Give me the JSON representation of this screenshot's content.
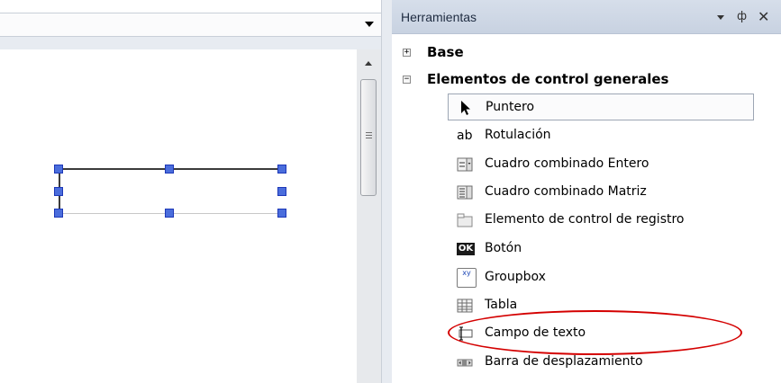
{
  "tool_panel": {
    "title": "Herramientas",
    "dropdown_icon": "chevron-down-icon",
    "pin_glyph": "ф",
    "close_glyph": "✕",
    "categories": [
      {
        "label": "Base",
        "expander": "+",
        "expanded": false
      },
      {
        "label": "Elementos de control generales",
        "expander": "−",
        "expanded": true
      }
    ],
    "items": [
      {
        "label": "Puntero",
        "icon": "pointer-arrow-icon",
        "selected": true
      },
      {
        "label": "Rotulación",
        "icon": "ab-label-icon",
        "icon_text": "ab"
      },
      {
        "label": "Cuadro combinado Entero",
        "icon": "combobox-integer-icon"
      },
      {
        "label": "Cuadro combinado Matriz",
        "icon": "combobox-matrix-icon"
      },
      {
        "label": "Elemento de control de registro",
        "icon": "tab-control-icon"
      },
      {
        "label": "Botón",
        "icon": "ok-button-icon",
        "icon_text": "OK"
      },
      {
        "label": "Groupbox",
        "icon": "groupbox-icon",
        "icon_text": "xy"
      },
      {
        "label": "Tabla",
        "icon": "table-icon"
      },
      {
        "label": "Campo de texto",
        "icon": "textfield-icon",
        "highlighted": true
      },
      {
        "label": "Barra de desplazamiento",
        "icon": "scrollbar-icon"
      }
    ]
  },
  "editor": {
    "dropdown_icon": "chevron-down-icon"
  },
  "colors": {
    "panel_header": "#cdd6e4",
    "handle_fill": "#4a6ddc",
    "highlight_ellipse": "#d40000"
  }
}
